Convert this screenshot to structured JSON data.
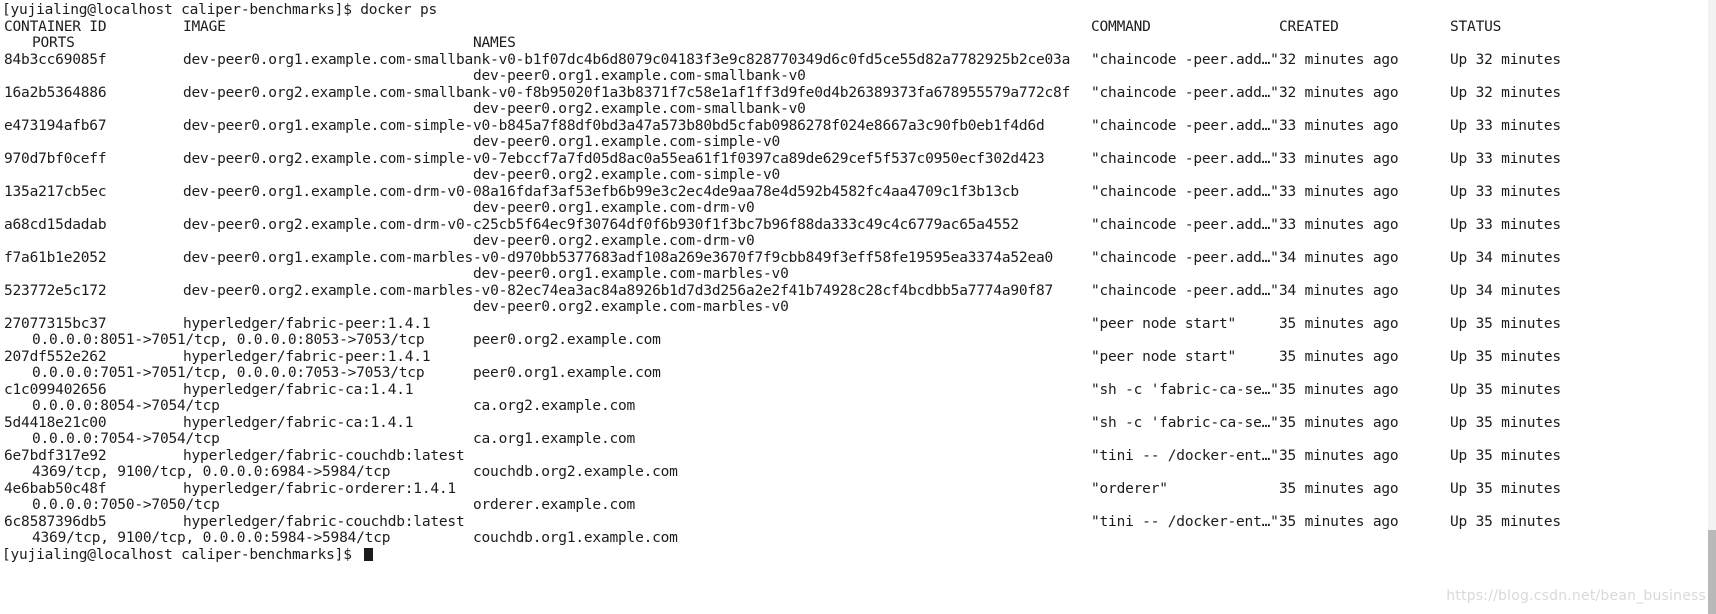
{
  "terminal": {
    "prompt_top": "[yujialing@localhost caliper-benchmarks]$ docker ps",
    "prompt_bottom": "[yujialing@localhost caliper-benchmarks]$ ",
    "watermark": "https://blog.csdn.net/bean_business",
    "colors": {
      "background": "#ffffff",
      "foreground": "#1c1c1c",
      "watermark": "#d9d9d9",
      "scrollbar": "#b9b9b9"
    }
  },
  "headers": {
    "container_id": "CONTAINER ID",
    "image": "IMAGE",
    "command": "COMMAND",
    "created": "CREATED",
    "status": "STATUS",
    "ports": "PORTS",
    "names": "NAMES"
  },
  "rows": [
    {
      "container_id": "84b3cc69085f",
      "image": "dev-peer0.org1.example.com-smallbank-v0-b1f07dc4b6d8079c04183f3e9c828770349d6c0fd5ce55d82a7782925b2ce03a",
      "command": "\"chaincode -peer.add…\"",
      "created": "32 minutes ago",
      "status": "Up 32 minutes",
      "ports": "",
      "names": "dev-peer0.org1.example.com-smallbank-v0"
    },
    {
      "container_id": "16a2b5364886",
      "image": "dev-peer0.org2.example.com-smallbank-v0-f8b95020f1a3b8371f7c58e1af1ff3d9fe0d4b26389373fa678955579a772c8f",
      "command": "\"chaincode -peer.add…\"",
      "created": "32 minutes ago",
      "status": "Up 32 minutes",
      "ports": "",
      "names": "dev-peer0.org2.example.com-smallbank-v0"
    },
    {
      "container_id": "e473194afb67",
      "image": "dev-peer0.org1.example.com-simple-v0-b845a7f88df0bd3a47a573b80bd5cfab0986278f024e8667a3c90fb0eb1f4d6d",
      "command": "\"chaincode -peer.add…\"",
      "created": "33 minutes ago",
      "status": "Up 33 minutes",
      "ports": "",
      "names": "dev-peer0.org1.example.com-simple-v0"
    },
    {
      "container_id": "970d7bf0ceff",
      "image": "dev-peer0.org2.example.com-simple-v0-7ebccf7a7fd05d8ac0a55ea61f1f0397ca89de629cef5f537c0950ecf302d423",
      "command": "\"chaincode -peer.add…\"",
      "created": "33 minutes ago",
      "status": "Up 33 minutes",
      "ports": "",
      "names": "dev-peer0.org2.example.com-simple-v0"
    },
    {
      "container_id": "135a217cb5ec",
      "image": "dev-peer0.org1.example.com-drm-v0-08a16fdaf3af53efb6b99e3c2ec4de9aa78e4d592b4582fc4aa4709c1f3b13cb",
      "command": "\"chaincode -peer.add…\"",
      "created": "33 minutes ago",
      "status": "Up 33 minutes",
      "ports": "",
      "names": "dev-peer0.org1.example.com-drm-v0"
    },
    {
      "container_id": "a68cd15dadab",
      "image": "dev-peer0.org2.example.com-drm-v0-c25cb5f64ec9f30764df0f6b930f1f3bc7b96f88da333c49c4c6779ac65a4552",
      "command": "\"chaincode -peer.add…\"",
      "created": "33 minutes ago",
      "status": "Up 33 minutes",
      "ports": "",
      "names": "dev-peer0.org2.example.com-drm-v0"
    },
    {
      "container_id": "f7a61b1e2052",
      "image": "dev-peer0.org1.example.com-marbles-v0-d970bb5377683adf108a269e3670f7f9cbb849f3eff58fe19595ea3374a52ea0",
      "command": "\"chaincode -peer.add…\"",
      "created": "34 minutes ago",
      "status": "Up 34 minutes",
      "ports": "",
      "names": "dev-peer0.org1.example.com-marbles-v0"
    },
    {
      "container_id": "523772e5c172",
      "image": "dev-peer0.org2.example.com-marbles-v0-82ec74ea3ac84a8926b1d7d3d256a2e2f41b74928c28cf4bcdbb5a7774a90f87",
      "command": "\"chaincode -peer.add…\"",
      "created": "34 minutes ago",
      "status": "Up 34 minutes",
      "ports": "",
      "names": "dev-peer0.org2.example.com-marbles-v0"
    },
    {
      "container_id": "27077315bc37",
      "image": "hyperledger/fabric-peer:1.4.1",
      "command": "\"peer node start\"",
      "created": "35 minutes ago",
      "status": "Up 35 minutes",
      "ports": "0.0.0.0:8051->7051/tcp, 0.0.0.0:8053->7053/tcp",
      "names": "peer0.org2.example.com"
    },
    {
      "container_id": "207df552e262",
      "image": "hyperledger/fabric-peer:1.4.1",
      "command": "\"peer node start\"",
      "created": "35 minutes ago",
      "status": "Up 35 minutes",
      "ports": "0.0.0.0:7051->7051/tcp, 0.0.0.0:7053->7053/tcp",
      "names": "peer0.org1.example.com"
    },
    {
      "container_id": "c1c099402656",
      "image": "hyperledger/fabric-ca:1.4.1",
      "command": "\"sh -c 'fabric-ca-se…\"",
      "created": "35 minutes ago",
      "status": "Up 35 minutes",
      "ports": "0.0.0.0:8054->7054/tcp",
      "names": "ca.org2.example.com"
    },
    {
      "container_id": "5d4418e21c00",
      "image": "hyperledger/fabric-ca:1.4.1",
      "command": "\"sh -c 'fabric-ca-se…\"",
      "created": "35 minutes ago",
      "status": "Up 35 minutes",
      "ports": "0.0.0.0:7054->7054/tcp",
      "names": "ca.org1.example.com"
    },
    {
      "container_id": "6e7bdf317e92",
      "image": "hyperledger/fabric-couchdb:latest",
      "command": "\"tini -- /docker-ent…\"",
      "created": "35 minutes ago",
      "status": "Up 35 minutes",
      "ports": "4369/tcp, 9100/tcp, 0.0.0.0:6984->5984/tcp",
      "names": "couchdb.org2.example.com"
    },
    {
      "container_id": "4e6bab50c48f",
      "image": "hyperledger/fabric-orderer:1.4.1",
      "command": "\"orderer\"",
      "created": "35 minutes ago",
      "status": "Up 35 minutes",
      "ports": "0.0.0.0:7050->7050/tcp",
      "names": "orderer.example.com"
    },
    {
      "container_id": "6c8587396db5",
      "image": "hyperledger/fabric-couchdb:latest",
      "command": "\"tini -- /docker-ent…\"",
      "created": "35 minutes ago",
      "status": "Up 35 minutes",
      "ports": "4369/tcp, 9100/tcp, 0.0.0.0:5984->5984/tcp",
      "names": "couchdb.org1.example.com"
    }
  ]
}
